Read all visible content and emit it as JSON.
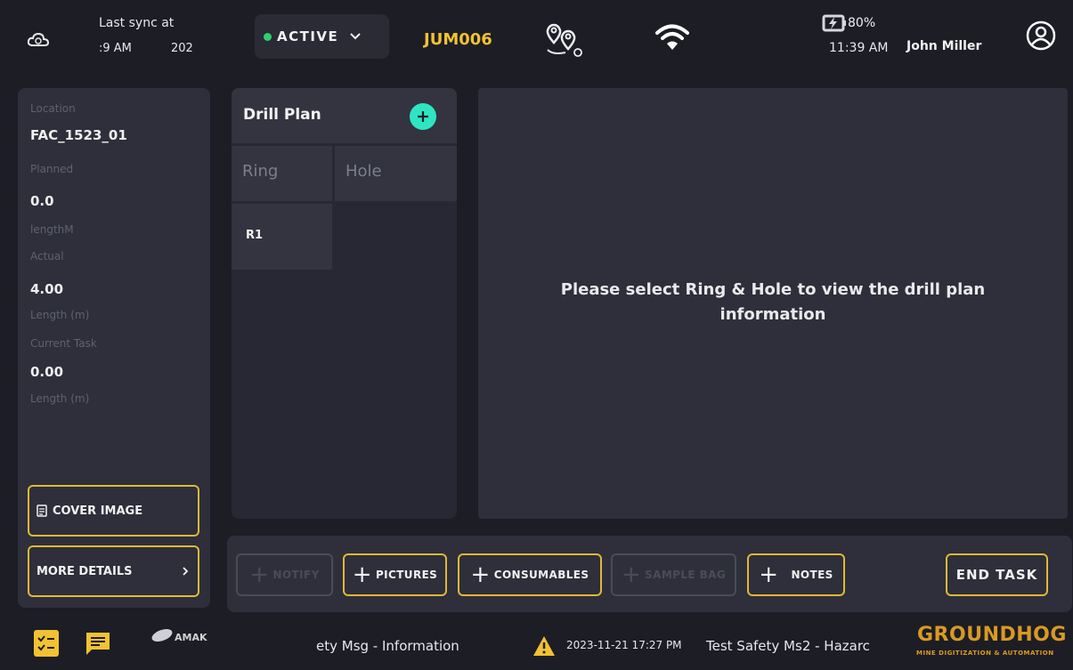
{
  "header": {
    "sync_label": "Last sync at",
    "sync_time": ":9 AM",
    "sync_year": "202",
    "status": "ACTIVE",
    "machine_id": "JUM006",
    "battery": "80%",
    "time": "11:39 AM",
    "user_name": "John Miller"
  },
  "sidebar": {
    "location_label": "Location",
    "location_value": "FAC_1523_01",
    "planned_label": "Planned",
    "planned_value": "0.0",
    "planned_unit": "lengthM",
    "actual_label": "Actual",
    "actual_value": "4.00",
    "actual_unit": "Length (m)",
    "current_label": "Current Task",
    "current_value": "0.00",
    "current_unit": "Length (m)",
    "cover_image_btn": "COVER IMAGE",
    "more_details_btn": "MORE DETAILS"
  },
  "drill_plan": {
    "title": "Drill Plan",
    "col_ring": "Ring",
    "col_hole": "Hole",
    "rows": [
      "R1"
    ]
  },
  "info": {
    "message": "Please select Ring & Hole to view the drill plan information"
  },
  "actions": {
    "notify": "NOTIFY",
    "pictures": "PICTURES",
    "consumables": "CONSUMABLES",
    "sample_bag": "SAMPLE BAG",
    "notes": "NOTES",
    "end_task": "END TASK"
  },
  "footer": {
    "ticker_left": "ety Msg - Information",
    "ticker_time": "2023-11-21 17:27 PM",
    "ticker_right": "Test Safety Ms2 - Hazarc",
    "brand": "GROUNDHOG",
    "brand_sub": "MINE DIGITIZATION & AUTOMATION",
    "partner_logo": "AMAK"
  },
  "colors": {
    "accent_yellow": "#e0b838",
    "active_green": "#2fd06c",
    "add_teal": "#2ee5c3",
    "brand_orange": "#d99a22"
  }
}
